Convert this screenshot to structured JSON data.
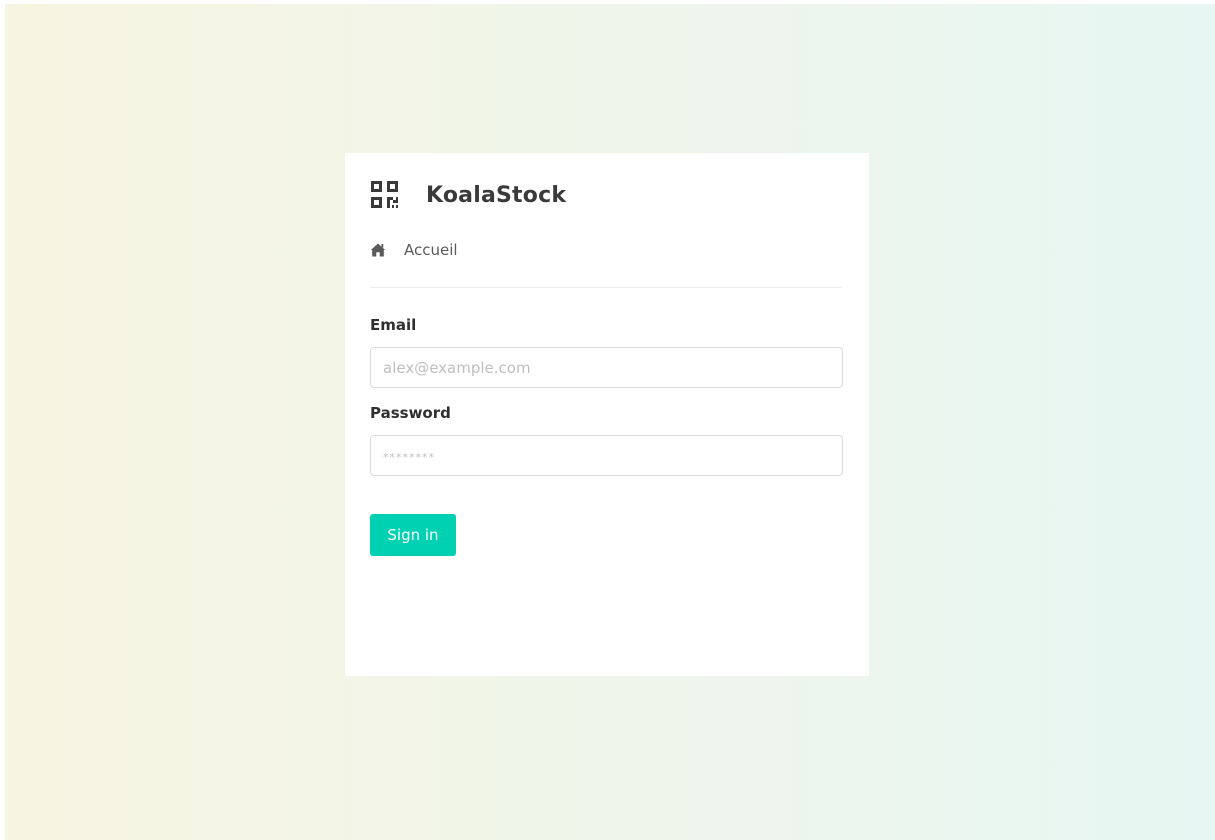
{
  "brand": {
    "name": "KoalaStock",
    "icon": "qrcode-icon"
  },
  "nav": {
    "home_label": "Accueil",
    "home_icon": "home-icon"
  },
  "form": {
    "email": {
      "label": "Email",
      "placeholder": "alex@example.com",
      "value": ""
    },
    "password": {
      "label": "Password",
      "placeholder": "********",
      "value": ""
    },
    "submit_label": "Sign in"
  },
  "colors": {
    "accent": "#00d1b2",
    "background_left": "#f7f5e2",
    "background_right": "#e7f6f3",
    "text": "#3a3a3a"
  }
}
